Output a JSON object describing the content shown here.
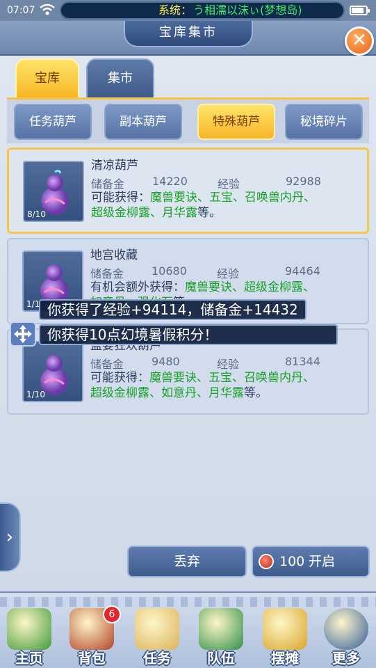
{
  "status_bar": {
    "time": "07:07",
    "system_prefix": "系统：",
    "system_message": "う相濡以沫ぃ(梦想岛)",
    "battery_level_percent": 85
  },
  "header": {
    "title": "宝库集市"
  },
  "main_tabs": [
    {
      "label": "宝库",
      "active": true
    },
    {
      "label": "集市",
      "active": false
    }
  ],
  "sub_tabs": [
    {
      "label": "任务葫芦",
      "active": false
    },
    {
      "label": "副本葫芦",
      "active": false
    },
    {
      "label": "特殊葫芦",
      "active": true
    },
    {
      "label": "秘境碎片",
      "active": false
    }
  ],
  "items": [
    {
      "name": "清凉葫芦",
      "count": "8/10",
      "reserve_label": "储备金",
      "reserve": "14220",
      "exp_label": "经验",
      "exp": "92988",
      "desc_prefix": "可能获得：",
      "desc_line1_green": "魔兽要诀、五宝、召唤兽内丹、",
      "desc_line2_green": "超级金柳露、月华露",
      "desc_line2_suffix": "等。",
      "selected": true
    },
    {
      "name": "地宫收藏",
      "count": "1/1",
      "reserve_label": "储备金",
      "reserve": "10680",
      "exp_label": "经验",
      "exp": "94464",
      "desc_prefix": "有机会额外获得：",
      "desc_line1_green": "魔兽要诀、超级金柳露、",
      "desc_line2_green": "如意丹、强化石",
      "desc_line2_suffix": "等",
      "selected": false
    },
    {
      "name": "盖要狂欢葫芦",
      "count": "1/10",
      "reserve_label": "储备金",
      "reserve": "9480",
      "exp_label": "经验",
      "exp": "81344",
      "desc_prefix": "可能获得：",
      "desc_line1_green": "魔兽要诀、五宝、召唤兽内丹、",
      "desc_line2_green": "超级金柳露、如意丹、月华露",
      "desc_line2_suffix": "等。",
      "selected": false
    }
  ],
  "toasts": [
    "你获得了经验+94114，储备金+14432",
    "你获得10点幻境暑假积分！"
  ],
  "actions": {
    "discard_label": "丢弃",
    "open_cost": "100",
    "open_label": "开启"
  },
  "bottom_nav": [
    {
      "label": "主页",
      "color": "#3f9a3a"
    },
    {
      "label": "背包",
      "color": "#b0442a",
      "badge": "6"
    },
    {
      "label": "任务",
      "color": "#d9b25a"
    },
    {
      "label": "队伍",
      "color": "#2f8f4a"
    },
    {
      "label": "摆摊",
      "color": "#d7a52a"
    },
    {
      "label": "更多",
      "color": "#2f5a9a"
    }
  ]
}
